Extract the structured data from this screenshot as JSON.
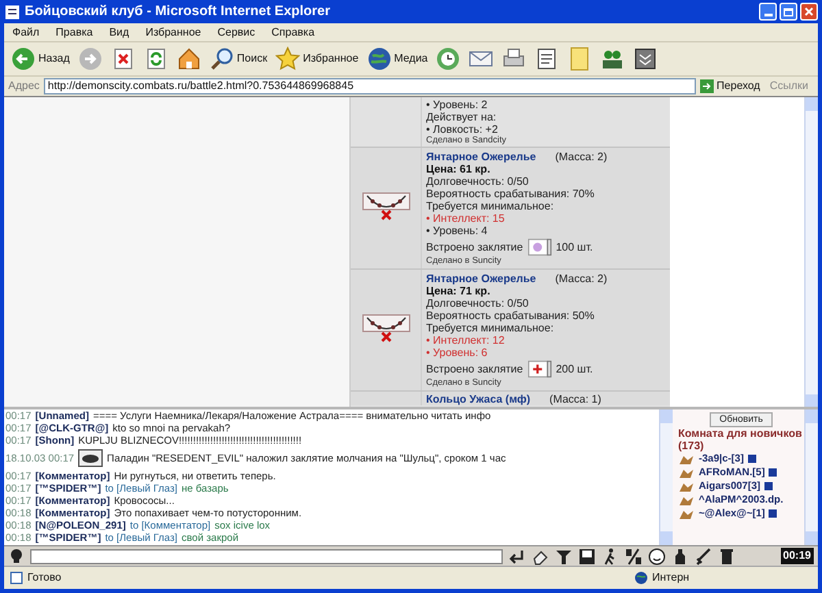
{
  "window": {
    "title": "Бойцовский клуб - Microsoft Internet Explorer"
  },
  "menu": [
    "Файл",
    "Правка",
    "Вид",
    "Избранное",
    "Сервис",
    "Справка"
  ],
  "toolbar": [
    {
      "kind": "back",
      "label": "Назад"
    },
    {
      "kind": "forward"
    },
    {
      "kind": "stop"
    },
    {
      "kind": "refresh"
    },
    {
      "kind": "home"
    },
    {
      "kind": "search",
      "label": "Поиск"
    },
    {
      "kind": "favorites",
      "label": "Избранное"
    },
    {
      "kind": "media",
      "label": "Медиа"
    },
    {
      "kind": "history"
    },
    {
      "kind": "mail"
    },
    {
      "kind": "print"
    },
    {
      "kind": "edit"
    },
    {
      "kind": "note"
    },
    {
      "kind": "people"
    },
    {
      "kind": "archive"
    }
  ],
  "address": {
    "label": "Адрес",
    "url": "http://demonscity.combats.ru/battle2.html?0.753644869968845",
    "go": "Переход",
    "links": "Ссылки"
  },
  "items": [
    {
      "kind": "tail",
      "lines": [
        {
          "kind": "text",
          "text": "• Уровень: 2"
        },
        {
          "kind": "text",
          "text": "Действует на:"
        },
        {
          "kind": "text",
          "text": "• Ловкость: +2"
        }
      ],
      "made": "Сделано в Sandcity"
    },
    {
      "kind": "full",
      "name": "Янтарное Ожерелье",
      "mass": "(Масса: 2)",
      "price": "Цена: 61 кр.",
      "lines": [
        {
          "kind": "text",
          "text": "Долговечность: 0/50"
        },
        {
          "kind": "text",
          "text": "Вероятность срабатывания: 70%"
        },
        {
          "kind": "text",
          "text": "Требуется минимальное:"
        },
        {
          "kind": "unmet",
          "text": "• Интеллект: 15"
        },
        {
          "kind": "text",
          "text": "• Уровень: 4"
        }
      ],
      "spell": {
        "kind": "charm",
        "label": "Встроено заклятие",
        "count": "100 шт."
      },
      "made": "Сделано в Suncity"
    },
    {
      "kind": "full",
      "name": "Янтарное Ожерелье",
      "mass": "(Масса: 2)",
      "price": "Цена: 71 кр.",
      "lines": [
        {
          "kind": "text",
          "text": "Долговечность: 0/50"
        },
        {
          "kind": "text",
          "text": "Вероятность срабатывания: 50%"
        },
        {
          "kind": "text",
          "text": "Требуется минимальное:"
        },
        {
          "kind": "unmet",
          "text": "• Интеллект: 12"
        },
        {
          "kind": "unmet",
          "text": "• Уровень: 6"
        }
      ],
      "spell": {
        "kind": "heal",
        "label": "Встроено заклятие",
        "count": "200 шт."
      },
      "made": "Сделано в Suncity"
    },
    {
      "kind": "head",
      "name": "Кольцо Ужаса (мф)",
      "mass": "(Масса: 1)"
    }
  ],
  "chat": [
    {
      "kind": "message",
      "time": "00:17",
      "user": "[Unnamed]",
      "text": "==== Услуги Наемника/Лекаря/Наложение Астрала==== внимательно читать инфо"
    },
    {
      "kind": "message",
      "time": "00:17",
      "user": "[@CLK-GTR@]",
      "text": "kto so mnoi na pervakah?"
    },
    {
      "kind": "message",
      "time": "00:17",
      "user": "[Shonn]",
      "text": "KUPLJU BLIZNECOV!!!!!!!!!!!!!!!!!!!!!!!!!!!!!!!!!!!!!!!!!!!"
    },
    {
      "kind": "system",
      "time": "18.10.03 00:17",
      "text": "Паладин \"RESEDENT_EVIL\" наложил заклятие молчания на \"Шульц\", сроком 1 час"
    },
    {
      "kind": "message",
      "time": "00:17",
      "user": "[Комментатор]",
      "text": "Ни ругнуться, ни ответить теперь."
    },
    {
      "kind": "message",
      "time": "00:17",
      "user": "[™SPIDER™]",
      "to": "to [Левый Глаз]",
      "text": "не базарь"
    },
    {
      "kind": "message",
      "time": "00:17",
      "user": "[Комментатор]",
      "text": "Кровососы..."
    },
    {
      "kind": "message",
      "time": "00:18",
      "user": "[Комментатор]",
      "text": "Это попахивает чем-то потусторонним."
    },
    {
      "kind": "message",
      "time": "00:18",
      "user": "[N@POLEON_291]",
      "to": "to [Комментатор]",
      "text": "sox icive lox"
    },
    {
      "kind": "message",
      "time": "00:18",
      "user": "[™SPIDER™]",
      "to": "to [Левый Глаз]",
      "text": "свой закрой"
    }
  ],
  "room": {
    "refresh": "Обновить",
    "title": "Комната для новичков (173)",
    "users": [
      {
        "name": "-3a9|c-[3]",
        "info": true
      },
      {
        "name": "AFRoMAN.[5]",
        "info": true
      },
      {
        "name": "Aigars007[3]",
        "info": true
      },
      {
        "name": "^AlaPM^2003.dp.",
        "info": false
      },
      {
        "name": "~@Alex@~[1]",
        "info": true
      }
    ]
  },
  "bottom_bar": {
    "tools": [
      {
        "kind": "enter"
      },
      {
        "kind": "eraser"
      },
      {
        "kind": "filter"
      },
      {
        "kind": "save"
      },
      {
        "kind": "walker"
      },
      {
        "kind": "pl"
      },
      {
        "kind": "smiley"
      },
      {
        "kind": "bottle"
      },
      {
        "kind": "sword"
      },
      {
        "kind": "trash"
      }
    ],
    "clock": "00:19"
  },
  "status_bar": {
    "text": "Готово",
    "zone": "Интерн"
  }
}
